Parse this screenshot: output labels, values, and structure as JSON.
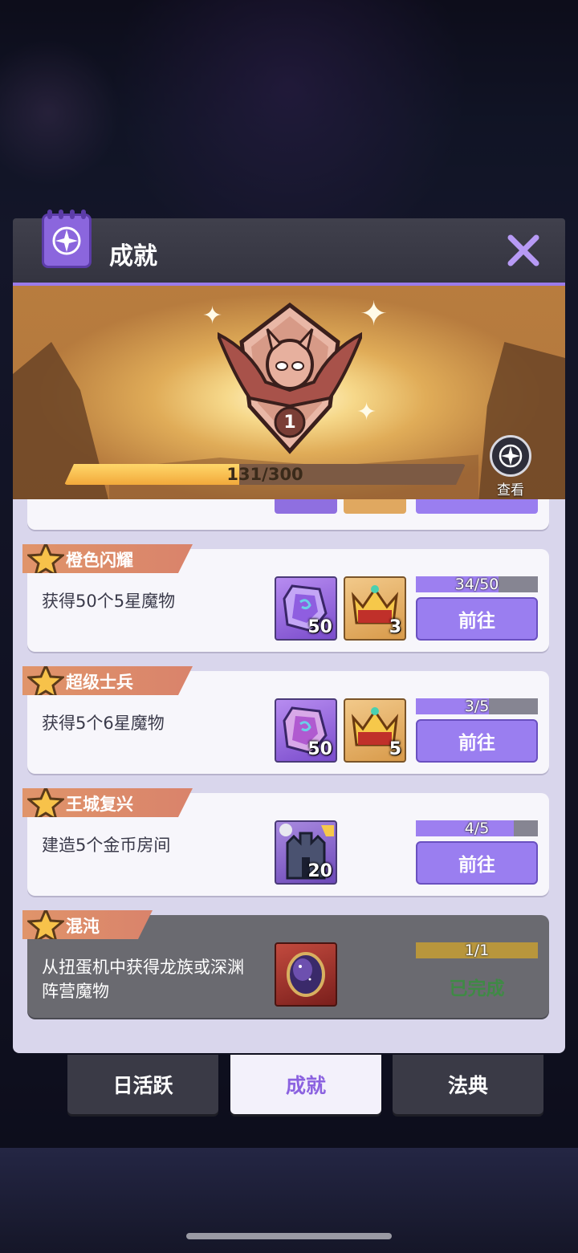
{
  "panel": {
    "title": "成就",
    "level": "1",
    "progress": {
      "current": 131,
      "max": 300,
      "text": "131/300"
    },
    "view_label": "查看"
  },
  "achievements": [
    {
      "name": "橙色闪耀",
      "desc": "获得50个5星魔物",
      "rewards": [
        {
          "icon": "purple-gem-icon",
          "qty": "50"
        },
        {
          "icon": "gold-crown-icon",
          "qty": "3"
        }
      ],
      "progress": {
        "current": 34,
        "max": 50,
        "text": "34/50"
      },
      "action": "前往"
    },
    {
      "name": "超级士兵",
      "desc": "获得5个6星魔物",
      "rewards": [
        {
          "icon": "purple-gem-icon",
          "qty": "50"
        },
        {
          "icon": "gold-crown-icon",
          "qty": "5"
        }
      ],
      "progress": {
        "current": 3,
        "max": 5,
        "text": "3/5"
      },
      "action": "前往"
    },
    {
      "name": "王城复兴",
      "desc": "建造5个金币房间",
      "rewards": [
        {
          "icon": "castle-icon",
          "qty": "20"
        }
      ],
      "progress": {
        "current": 4,
        "max": 5,
        "text": "4/5"
      },
      "action": "前往"
    },
    {
      "name": "混沌",
      "desc": "从扭蛋机中获得龙族或深渊阵营魔物",
      "rewards": [
        {
          "icon": "dark-orb-icon",
          "qty": ""
        }
      ],
      "progress": {
        "current": 1,
        "max": 1,
        "text": "1/1"
      },
      "status": "已完成"
    }
  ],
  "tabs": [
    {
      "label": "日活跃",
      "active": false
    },
    {
      "label": "成就",
      "active": true
    },
    {
      "label": "法典",
      "active": false
    }
  ],
  "colors": {
    "accent": "#9a7ef0",
    "tag": "#d9836b",
    "done": "#3f8a45"
  }
}
